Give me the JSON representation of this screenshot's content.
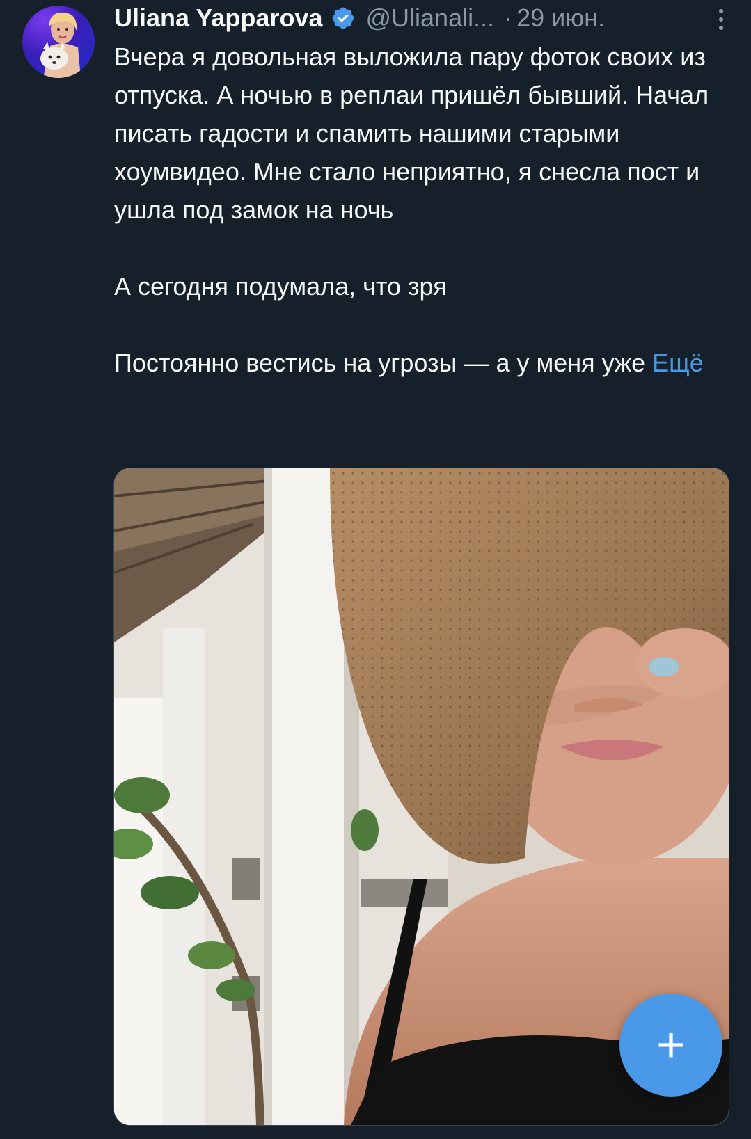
{
  "tweet": {
    "author_name": "Uliana Yapparova",
    "handle": "@Ulianali...",
    "separator": "·",
    "date": "29 июн.",
    "paragraphs": [
      "Вчера я довольная выложила пару фоток своих из отпуска. А ночью в реплаи пришёл бывший. Начал писать гадости и спамить нашими старыми хоумвидео. Мне стало неприятно, я снесла пост и ушла под замок на ночь",
      "А сегодня подумала, что зря",
      "Постоянно вестись на угрозы — а у меня уже"
    ],
    "more_label": "Ещё",
    "verified_icon": "verified-badge-icon",
    "more_icon": "more-vertical-icon"
  },
  "fab": {
    "label": "+",
    "icon": "compose-plus-icon"
  },
  "colors": {
    "background": "#15202b",
    "text": "#f7f9f9",
    "secondary_text": "#8b98a5",
    "accent": "#4a99e9"
  }
}
